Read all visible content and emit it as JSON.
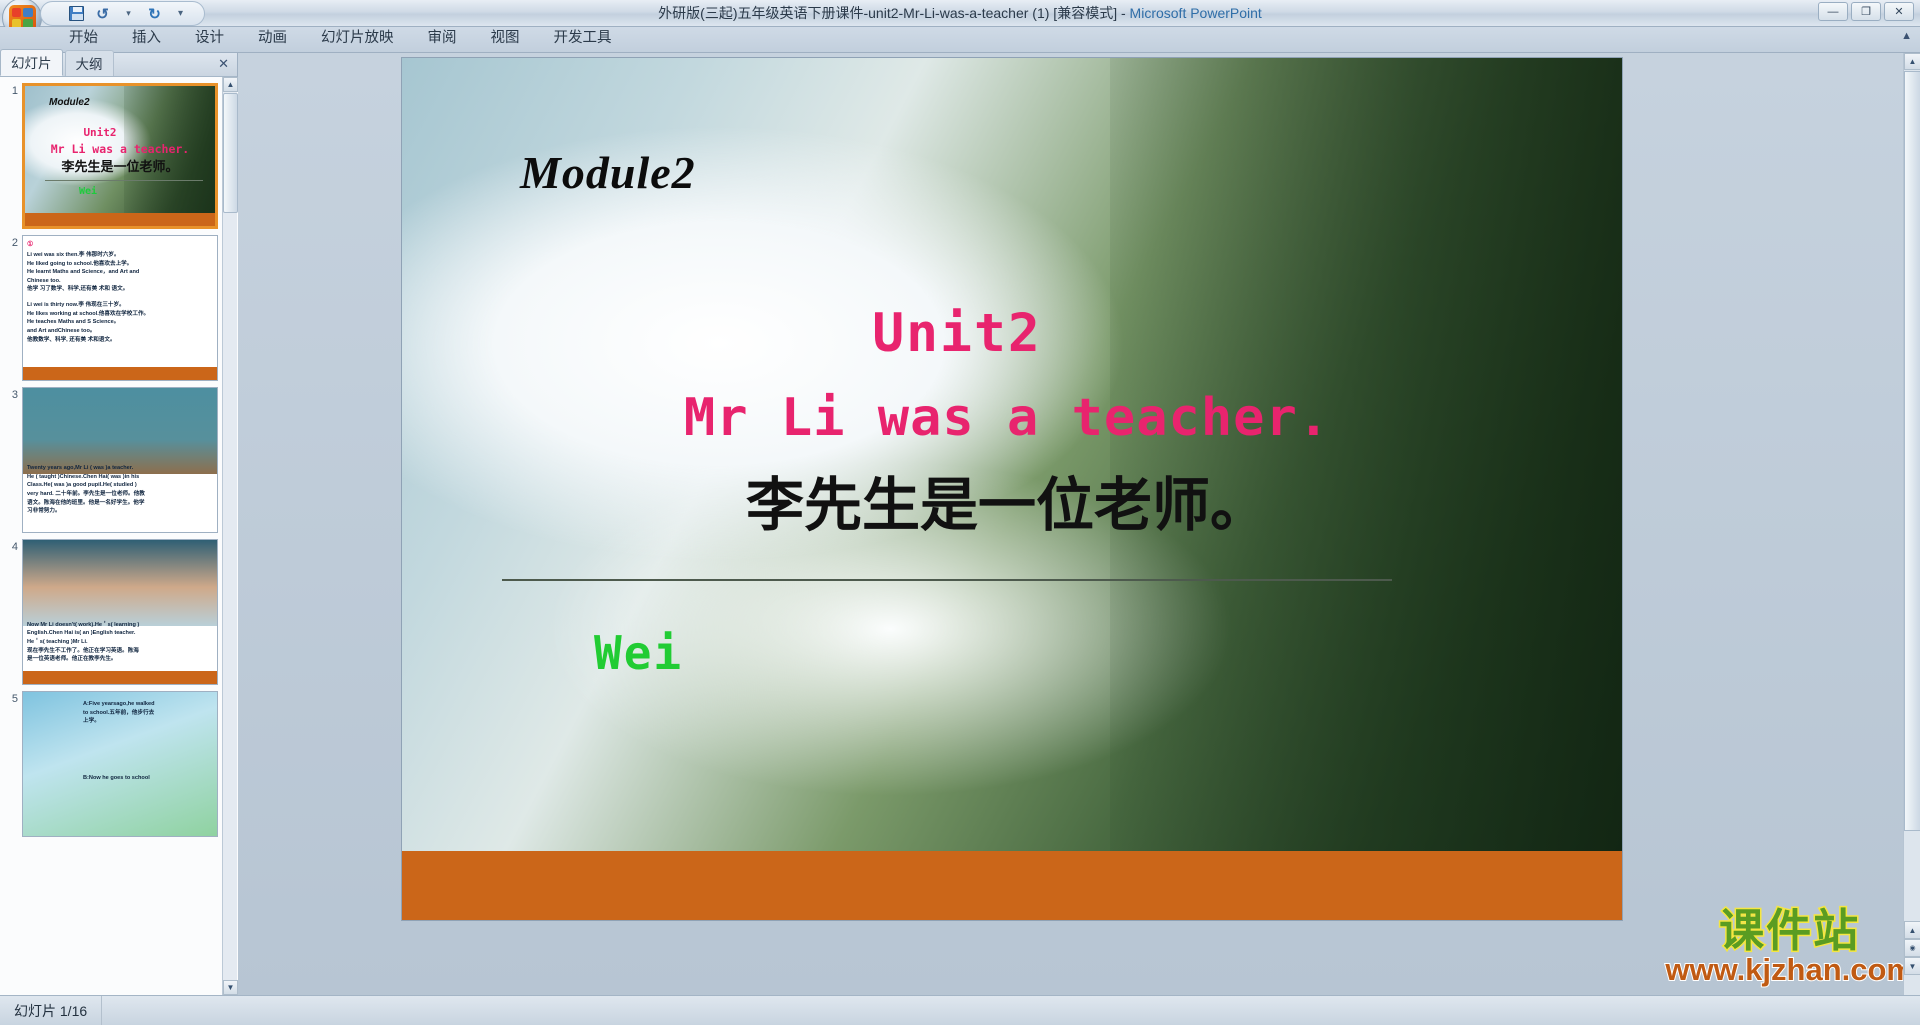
{
  "window": {
    "title": "外研版(三起)五年级英语下册课件-unit2-Mr-Li-was-a-teacher (1) [兼容模式]",
    "separator": " - ",
    "app_name": "Microsoft PowerPoint",
    "minimize": "—",
    "maximize": "❐",
    "close": "✕"
  },
  "quick_access": {
    "save": "💾",
    "undo": "↺",
    "redo": "↻",
    "customize": "▾"
  },
  "ribbon": {
    "tabs": [
      {
        "label": "开始"
      },
      {
        "label": "插入"
      },
      {
        "label": "设计"
      },
      {
        "label": "动画"
      },
      {
        "label": "幻灯片放映"
      },
      {
        "label": "审阅"
      },
      {
        "label": "视图"
      },
      {
        "label": "开发工具"
      }
    ],
    "collapse": "▲"
  },
  "left_pane": {
    "tabs": [
      {
        "label": "幻灯片",
        "active": true
      },
      {
        "label": "大纲",
        "active": false
      }
    ],
    "close": "✕",
    "scroll_up": "▲",
    "scroll_down": "▼"
  },
  "slides": [
    {
      "number": "1",
      "module": "Module2",
      "unit": "Unit2",
      "title_en": "Mr Li was a teacher.",
      "title_cn": "李先生是一位老师。",
      "author": "Wei"
    },
    {
      "number": "2",
      "lines": [
        "Li wei was six then.李 伟那时六岁。",
        "He liked going to school.他喜欢去上学。",
        "He learnt Maths and Science，and Art and",
        "Chinese too.",
        "他学 习了数学、科学,还有美 术和 语文。",
        "Li wei is thirty now.李 伟现在三十岁。",
        "He likes working at school.他喜欢在学校工作。",
        "He teaches Maths and S Science。",
        "and Art andChinese too。",
        "他教数学、科学, 还有美 术和语文。"
      ]
    },
    {
      "number": "3",
      "lines": [
        "Twenty years ago,Mr Li ( was )a teacher.",
        "He ( taught  )Chinese.Chen Hai( was )in his",
        "Class.He( was )a good pupil.He( studied )",
        "very hard. 二十年前。李先生是一位老师。他教",
        "语文。陈海在他的班里。他是一名好学生。他学",
        "习非常努力。"
      ]
    },
    {
      "number": "4",
      "lines": [
        "Now Mr Li doesn't( work).He＇s( learning )",
        "English.Chen Hai is( an )English teacher.",
        "He＇s( teaching )Mr Li.",
        "现在李先生不工作了。他正在学习英语。陈海",
        "是一位英语老师。他正在教李先生。"
      ]
    },
    {
      "number": "5",
      "lines": [
        "A:Five yearsago,he walked",
        "to school.五年前，他步行去",
        "上学。",
        "B:Now he goes to school"
      ]
    }
  ],
  "stage": {
    "scroll_up": "▲",
    "scroll_down": "▼",
    "prev_slide": "▲",
    "next_slide": "▼",
    "slide_browse": "◉"
  },
  "watermark": {
    "cn": "课件站",
    "url": "www.kjzhan.com"
  },
  "status": {
    "slide_counter": "幻灯片 1/16"
  }
}
